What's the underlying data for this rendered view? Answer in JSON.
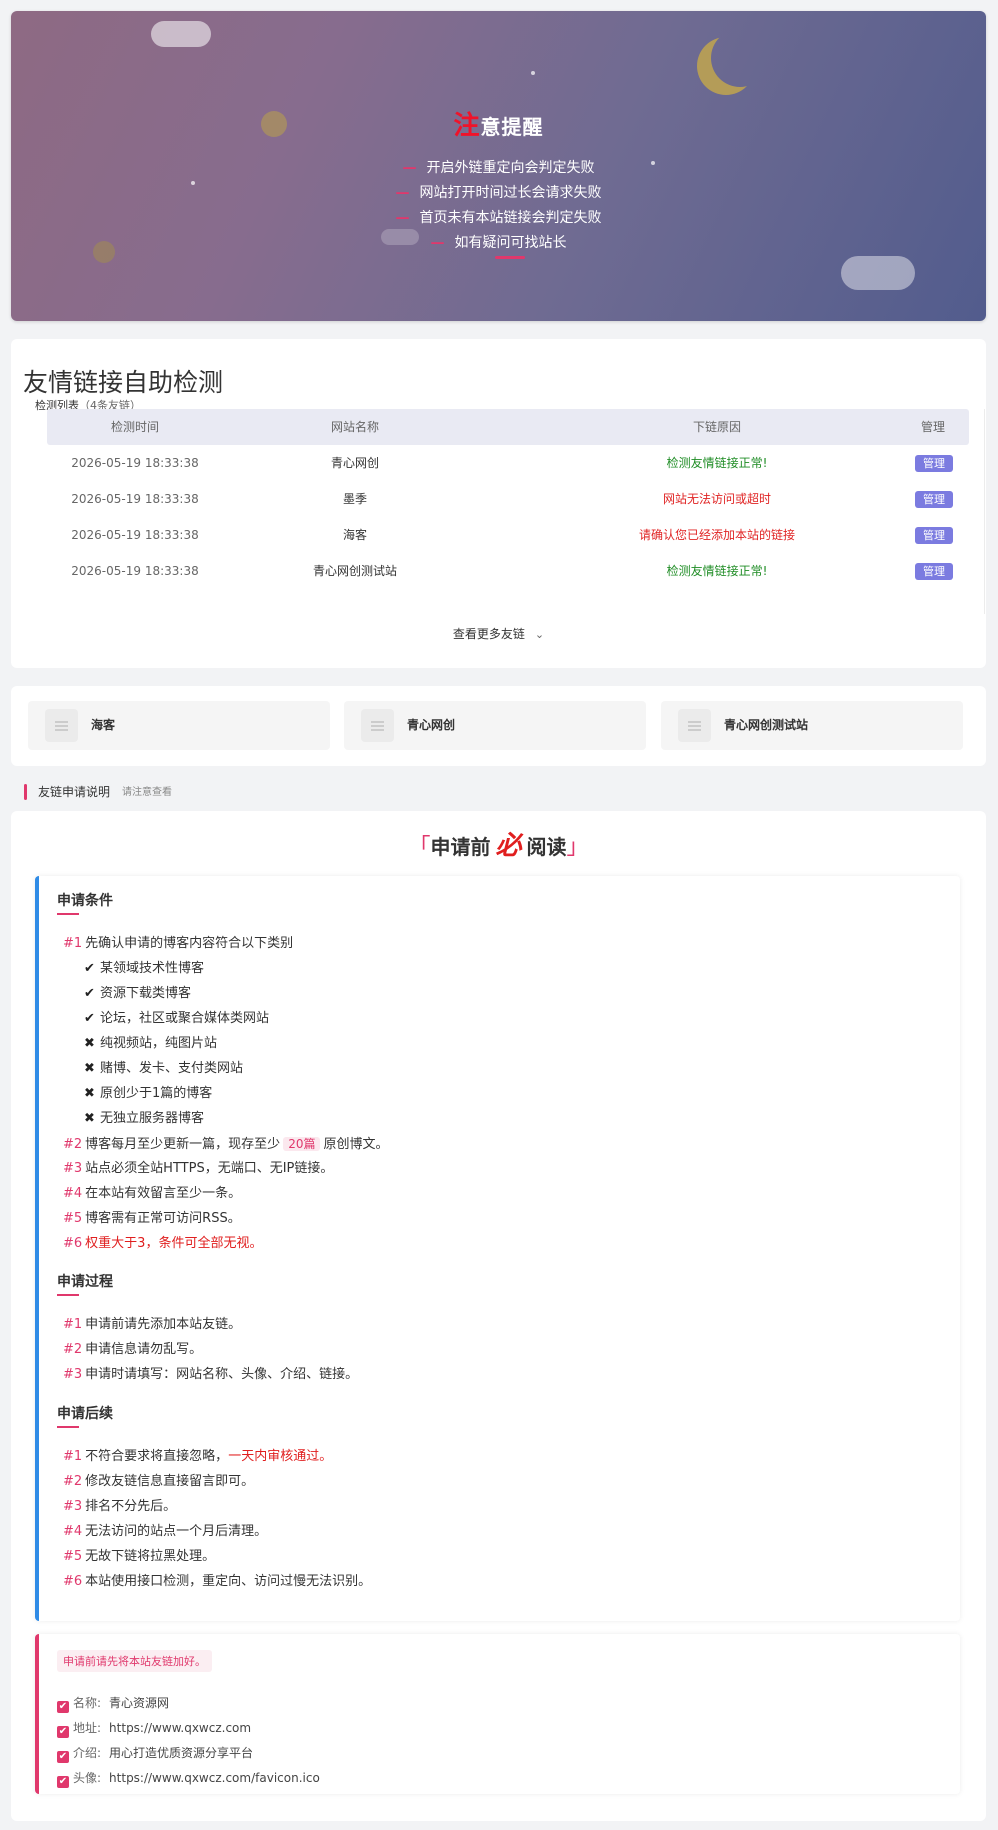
{
  "hero": {
    "title_first": "注",
    "title_rest": "意提醒",
    "items": [
      "开启外链重定向会判定失败",
      "网站打开时间过长会请求失败",
      "首页未有本站链接会判定失败",
      "如有疑问可找站长"
    ],
    "dash": "—"
  },
  "check": {
    "title": "友情链接自助检测",
    "subtitle": "检测列表",
    "count": "（4条友链）",
    "headers": {
      "time": "检测时间",
      "name": "网站名称",
      "reason": "下链原因",
      "manage": "管理"
    },
    "rows": [
      {
        "time": "2026-05-19 18:33:38",
        "name": "青心网创",
        "reason": "检测友情链接正常!",
        "status": "ok",
        "manage": "管理"
      },
      {
        "time": "2026-05-19 18:33:38",
        "name": "墨季",
        "reason": "网站无法访问或超时",
        "status": "err",
        "manage": "管理"
      },
      {
        "time": "2026-05-19 18:33:38",
        "name": "海客",
        "reason": "请确认您已经添加本站的链接",
        "status": "err",
        "manage": "管理"
      },
      {
        "time": "2026-05-19 18:33:38",
        "name": "青心网创测试站",
        "reason": "检测友情链接正常!",
        "status": "ok",
        "manage": "管理"
      }
    ],
    "more": "查看更多友链",
    "more_icon": "chevron-down-icon"
  },
  "links": [
    {
      "name": "海客"
    },
    {
      "name": "青心网创"
    },
    {
      "name": "青心网创测试站"
    }
  ],
  "section": {
    "title": "友链申请说明",
    "sub": "请注意查看"
  },
  "rules": {
    "bracket_left": "「",
    "title_a": "申请前",
    "title_must": "必",
    "title_b": "阅读",
    "bracket_right": "」",
    "cond_title": "申请条件",
    "cond": [
      {
        "num": "#1",
        "text": "先确认申请的博客内容符合以下类别"
      },
      {
        "num": "#2",
        "text_a": "博客每月至少更新一篇，现存至少",
        "chip": "20篇",
        "text_b": "原创博文。"
      },
      {
        "num": "#3",
        "text": "站点必须全站HTTPS，无端口、无IP链接。"
      },
      {
        "num": "#4",
        "text": "在本站有效留言至少一条。"
      },
      {
        "num": "#5",
        "text": "博客需有正常可访问RSS。"
      },
      {
        "num": "#6",
        "text": "权重大于3，条件可全部无视。"
      }
    ],
    "categories": [
      {
        "mark": "✔",
        "text": "某领域技术性博客"
      },
      {
        "mark": "✔",
        "text": "资源下载类博客"
      },
      {
        "mark": "✔",
        "text": "论坛，社区或聚合媒体类网站"
      },
      {
        "mark": "✖",
        "text": "纯视频站，纯图片站"
      },
      {
        "mark": "✖",
        "text": "赌博、发卡、支付类网站"
      },
      {
        "mark": "✖",
        "text": "原创少于1篇的博客"
      },
      {
        "mark": "✖",
        "text": "无独立服务器博客"
      }
    ],
    "proc_title": "申请过程",
    "proc": [
      {
        "num": "#1",
        "text": "申请前请先添加本站友链。"
      },
      {
        "num": "#2",
        "text": "申请信息请勿乱写。"
      },
      {
        "num": "#3",
        "text": "申请时请填写：网站名称、头像、介绍、链接。"
      }
    ],
    "after_title": "申请后续",
    "after": [
      {
        "num": "#1",
        "text_a": "不符合要求将直接忽略，",
        "red": "一天内审核通过。"
      },
      {
        "num": "#2",
        "text": "修改友链信息直接留言即可。"
      },
      {
        "num": "#3",
        "text": "排名不分先后。"
      },
      {
        "num": "#4",
        "text": "无法访问的站点一个月后清理。"
      },
      {
        "num": "#5",
        "text": "无故下链将拉黑处理。"
      },
      {
        "num": "#6",
        "text": "本站使用接口检测，重定向、访问过慢无法识别。"
      }
    ]
  },
  "info": {
    "tip": "申请前请先将本站友链加好。",
    "check_icon": "✔",
    "rows": [
      {
        "label": "名称:",
        "value": "青心资源网"
      },
      {
        "label": "地址:",
        "value": "https://www.qxwcz.com"
      },
      {
        "label": "介绍:",
        "value": "用心打造优质资源分享平台"
      },
      {
        "label": "头像:",
        "value": "https://www.qxwcz.com/favicon.ico"
      }
    ]
  },
  "colors": {
    "accent": "#e0386c",
    "blue": "#2f8be6",
    "badge": "#7b7be0",
    "ok": "#1e8c24",
    "err": "#e02424"
  }
}
